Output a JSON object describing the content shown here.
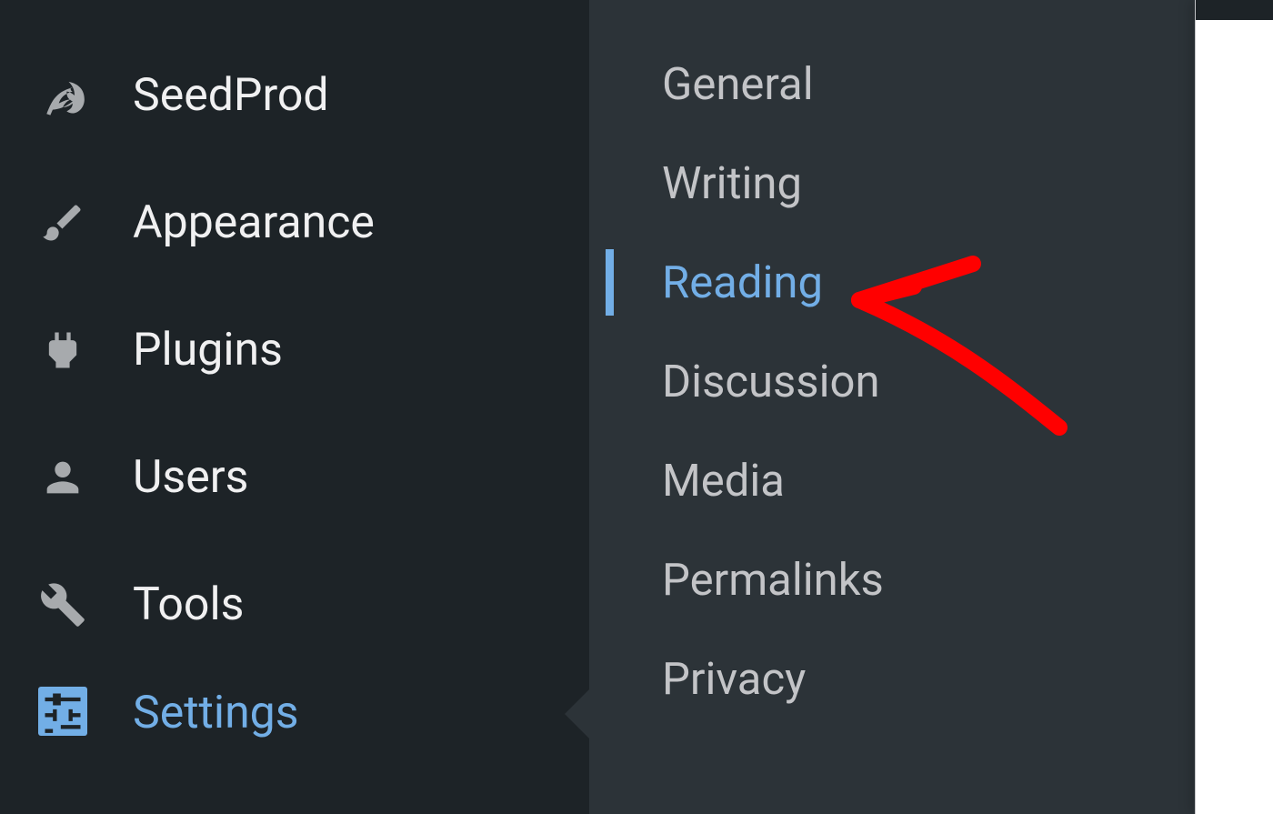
{
  "sidebar": {
    "items": [
      {
        "id": "seedprod",
        "label": "SeedProd",
        "icon": "leaf",
        "active": false
      },
      {
        "id": "appearance",
        "label": "Appearance",
        "icon": "brush",
        "active": false
      },
      {
        "id": "plugins",
        "label": "Plugins",
        "icon": "plug",
        "active": false
      },
      {
        "id": "users",
        "label": "Users",
        "icon": "user",
        "active": false
      },
      {
        "id": "tools",
        "label": "Tools",
        "icon": "wrench",
        "active": false
      },
      {
        "id": "settings",
        "label": "Settings",
        "icon": "sliders",
        "active": true
      }
    ]
  },
  "submenu": {
    "items": [
      {
        "id": "general",
        "label": "General",
        "active": false
      },
      {
        "id": "writing",
        "label": "Writing",
        "active": false
      },
      {
        "id": "reading",
        "label": "Reading",
        "active": true
      },
      {
        "id": "discussion",
        "label": "Discussion",
        "active": false
      },
      {
        "id": "media",
        "label": "Media",
        "active": false
      },
      {
        "id": "permalinks",
        "label": "Permalinks",
        "active": false
      },
      {
        "id": "privacy",
        "label": "Privacy",
        "active": false
      }
    ]
  },
  "colors": {
    "sidebar_bg": "#1d2327",
    "submenu_bg": "#2c3338",
    "text_default": "#f0f0f1",
    "text_muted": "#c3c4c7",
    "icon_default": "#a7aaad",
    "accent": "#72aee6",
    "annotation": "#ff0000"
  }
}
